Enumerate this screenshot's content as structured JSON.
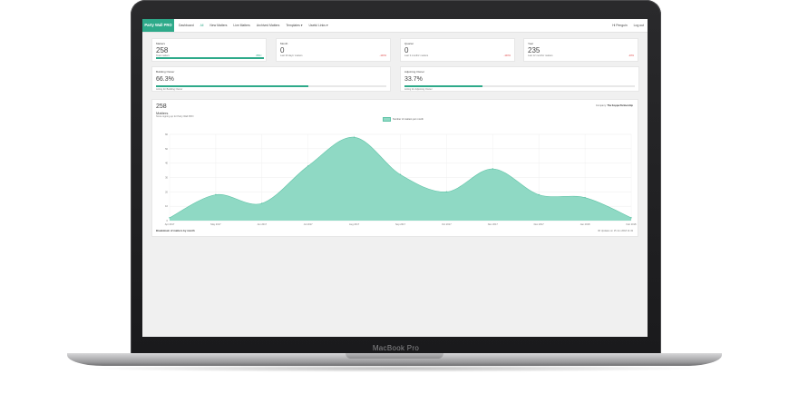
{
  "device": {
    "label": "MacBook Pro"
  },
  "app": {
    "brand": "Party Wall PRO"
  },
  "nav": {
    "items": [
      "Dashboard",
      "All",
      "New Matters",
      "Live Matters",
      "Archived Matters",
      "Templates ▾",
      "Useful Links ▾"
    ],
    "active_index": 1,
    "right": [
      "Hi Penguin",
      "Log out"
    ]
  },
  "stats": [
    {
      "label": "Matters",
      "value": "258",
      "sub": "Total matters",
      "pct": "88%↑",
      "pct_color": "#2eaa8a",
      "bar_color": "#2eaa8a",
      "bar_fill": 1.0
    },
    {
      "label": "Month",
      "value": "0",
      "sub": "Last 30 days' matters",
      "pct": "-100%",
      "pct_color": "#e04b4b",
      "bar_color": "#e04b4b",
      "bar_fill": 0.0
    },
    {
      "label": "Quarter",
      "value": "0",
      "sub": "Last 3 months' matters",
      "pct": "-100%",
      "pct_color": "#e04b4b",
      "bar_color": "#e04b4b",
      "bar_fill": 0.0
    },
    {
      "label": "Year",
      "value": "235",
      "sub": "Last 12 months' matters",
      "pct": "-20%",
      "pct_color": "#e04b4b",
      "bar_color": "#e04b4b",
      "bar_fill": 0.0
    }
  ],
  "progress": [
    {
      "label": "Building Owner",
      "value": "66.3%",
      "fill": 0.663,
      "foot": "Acting for Building Owner"
    },
    {
      "label": "Adjoining Owner",
      "value": "33.7%",
      "fill": 0.337,
      "foot": "Acting for Adjoining Owner"
    }
  ],
  "chart_card": {
    "total": "258",
    "label": "Matters",
    "sub": "Since signing up for Party Wall PRO",
    "company_prefix": "Company:",
    "company_name": "The Koppa Partnership",
    "footer_left": "Breakdown of matters by month",
    "footer_right": "30 Updates on 15 Jun 2018 11:43"
  },
  "chart_data": {
    "type": "area",
    "legend": "Number of matters per month",
    "categories": [
      "Apr 2017",
      "May 2017",
      "Jun 2017",
      "Jul 2017",
      "Aug 2017",
      "Sep 2017",
      "Oct 2017",
      "Nov 2017",
      "Dec 2017",
      "Jan 2018",
      "Feb 2018"
    ],
    "values": [
      2,
      18,
      12,
      38,
      58,
      32,
      20,
      36,
      18,
      16,
      2
    ],
    "yticks": [
      0,
      10,
      20,
      30,
      40,
      50,
      60
    ],
    "ylim": [
      0,
      60
    ],
    "color": "#8fd9c4",
    "stroke": "#5fc3a6"
  }
}
